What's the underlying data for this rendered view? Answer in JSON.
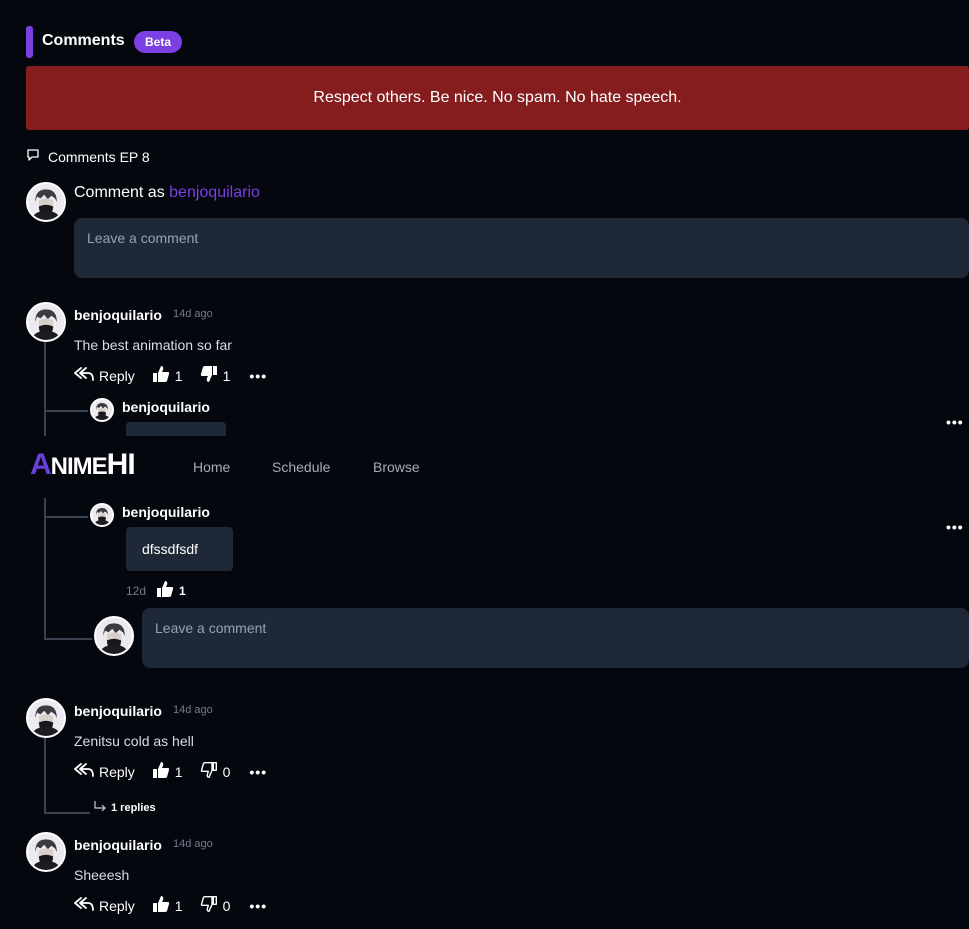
{
  "header": {
    "title": "Comments",
    "badge": "Beta",
    "notice": "Respect others. Be nice. No spam. No hate speech.",
    "comments_label": "Comments EP 8"
  },
  "compose": {
    "prefix": "Comment as",
    "username": "benjoquilario",
    "placeholder": "Leave a comment"
  },
  "navbar": {
    "logo_a": "A",
    "logo_nime": "NIME",
    "logo_hi": "HI",
    "items": [
      "Home",
      "Schedule",
      "Browse"
    ]
  },
  "comments": [
    {
      "username": "benjoquilario",
      "time": "14d ago",
      "text": "The best animation so far",
      "reply_label": "Reply",
      "likes": "1",
      "dislikes": "1",
      "replies": [
        {
          "username": "benjoquilario"
        },
        {
          "username": "benjoquilario",
          "text": "dfssdfsdf",
          "time": "12d",
          "likes": "1"
        }
      ],
      "reply_placeholder": "Leave a comment"
    },
    {
      "username": "benjoquilario",
      "time": "14d ago",
      "text": "Zenitsu cold as hell",
      "reply_label": "Reply",
      "likes": "1",
      "dislikes": "0",
      "replies_toggle": "1 replies"
    },
    {
      "username": "benjoquilario",
      "time": "14d ago",
      "text": "Sheeesh",
      "reply_label": "Reply",
      "likes": "1",
      "dislikes": "0"
    }
  ],
  "colors": {
    "accent": "#7b3fe4",
    "notice_bg": "#851d1f",
    "page_bg": "#05070f",
    "input_bg": "#1f2836"
  }
}
